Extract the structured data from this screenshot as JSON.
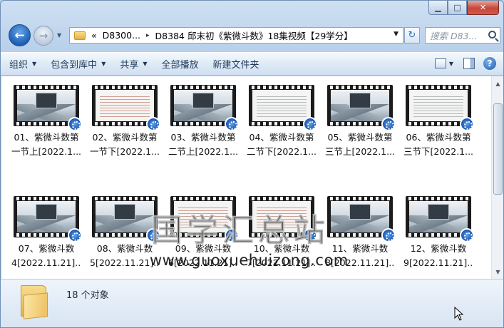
{
  "window": {
    "caption": {
      "minimize": "▁",
      "maximize": "□",
      "close": "✕"
    }
  },
  "nav": {
    "back_glyph": "←",
    "forward_glyph": "→",
    "dropdown_glyph": "▼",
    "breadcrumb": [
      "«",
      "D8300...",
      "▸",
      "D8384 邱末初《紫微斗数》18集视频【29学分】"
    ],
    "address_dropdown_glyph": "▼",
    "refresh_glyph": "↻",
    "search_placeholder": "搜索 D83..."
  },
  "toolbar": {
    "items": [
      "组织",
      "包含到库中",
      "共享",
      "全部播放",
      "新建文件夹"
    ],
    "arrow_glyph": "▼",
    "help_glyph": "?"
  },
  "files": [
    {
      "line1": "01、紫微斗数第",
      "line2": "一节上[2022.1...",
      "thumb": "landscape"
    },
    {
      "line1": "02、紫微斗数第",
      "line2": "一节下[2022.1...",
      "thumb": "doc-red"
    },
    {
      "line1": "03、紫微斗数第",
      "line2": "二节上[2022.1...",
      "thumb": "landscape"
    },
    {
      "line1": "04、紫微斗数第",
      "line2": "二节下[2022.1...",
      "thumb": "doc"
    },
    {
      "line1": "05、紫微斗数第",
      "line2": "三节上[2022.1...",
      "thumb": "landscape"
    },
    {
      "line1": "06、紫微斗数第",
      "line2": "三节下[2022.1...",
      "thumb": "doc"
    },
    {
      "line1": "07、紫微斗数",
      "line2": "4[2022.11.21]....",
      "thumb": "landscape"
    },
    {
      "line1": "08、紫微斗数",
      "line2": "5[2022.11.21]....",
      "thumb": "landscape"
    },
    {
      "line1": "09、紫微斗数",
      "line2": "6[2022.11.21]....",
      "thumb": "doc-red"
    },
    {
      "line1": "10、紫微斗数",
      "line2": "7[2022.11.21]....",
      "thumb": "doc-red"
    },
    {
      "line1": "11、紫微斗数",
      "line2": "8[2022.11.21]....",
      "thumb": "landscape"
    },
    {
      "line1": "12、紫微斗数",
      "line2": "9[2022.11.21]....",
      "thumb": "landscape"
    }
  ],
  "watermark": {
    "title": "国学汇总站",
    "url": "www.guoxuehuizong.com"
  },
  "scrollbar": {
    "up_glyph": "▲",
    "down_glyph": "▼"
  },
  "status": {
    "count_text": "18 个对象"
  }
}
